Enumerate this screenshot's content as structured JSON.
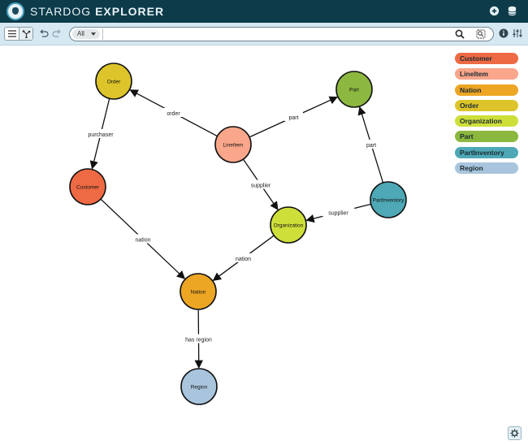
{
  "app": {
    "brand_light": "STARDOG",
    "brand_bold": "EXPLORER"
  },
  "toolbar": {
    "view_list_icon": "list-icon",
    "view_graph_icon": "graph-icon",
    "undo_icon": "undo-icon",
    "redo_icon": "redo-icon"
  },
  "search": {
    "filter_value": "All",
    "query": "",
    "placeholder": ""
  },
  "topbar_icons": [
    "add-icon",
    "database-icon"
  ],
  "colors": {
    "topbar": "#0d3b4a",
    "toolbar": "#d6e8f2",
    "Customer": "#ee6a44",
    "LineItem": "#f9a68a",
    "Nation": "#eda624",
    "Order": "#ddc42a",
    "Organization": "#cfdf3a",
    "Part": "#8cb840",
    "PartInventory": "#4ea8b6",
    "Region": "#a8c5dd"
  },
  "legend": [
    {
      "label": "Customer",
      "color": "#ee6a44"
    },
    {
      "label": "LineItem",
      "color": "#f9a68a"
    },
    {
      "label": "Nation",
      "color": "#eda624"
    },
    {
      "label": "Order",
      "color": "#ddc42a"
    },
    {
      "label": "Organization",
      "color": "#cfdf3a"
    },
    {
      "label": "Part",
      "color": "#8cb840"
    },
    {
      "label": "PartInventory",
      "color": "#4ea8b6"
    },
    {
      "label": "Region",
      "color": "#a8c5dd"
    }
  ],
  "graph": {
    "nodes": [
      {
        "id": "Order",
        "label": "Order"
      },
      {
        "id": "Part",
        "label": "Part"
      },
      {
        "id": "LineItem",
        "label": "LineItem"
      },
      {
        "id": "Customer",
        "label": "Customer"
      },
      {
        "id": "PartInventory",
        "label": "PartInventory"
      },
      {
        "id": "Organization",
        "label": "Organization"
      },
      {
        "id": "Nation",
        "label": "Nation"
      },
      {
        "id": "Region",
        "label": "Region"
      }
    ],
    "edges": [
      {
        "from": "LineItem",
        "to": "Order",
        "label": "order"
      },
      {
        "from": "LineItem",
        "to": "Part",
        "label": "part"
      },
      {
        "from": "Order",
        "to": "Customer",
        "label": "purchaser"
      },
      {
        "from": "LineItem",
        "to": "Organization",
        "label": "supplier"
      },
      {
        "from": "PartInventory",
        "to": "Part",
        "label": "part"
      },
      {
        "from": "PartInventory",
        "to": "Organization",
        "label": "supplier"
      },
      {
        "from": "Customer",
        "to": "Nation",
        "label": "nation"
      },
      {
        "from": "Organization",
        "to": "Nation",
        "label": "nation"
      },
      {
        "from": "Nation",
        "to": "Region",
        "label": "has region"
      }
    ]
  }
}
